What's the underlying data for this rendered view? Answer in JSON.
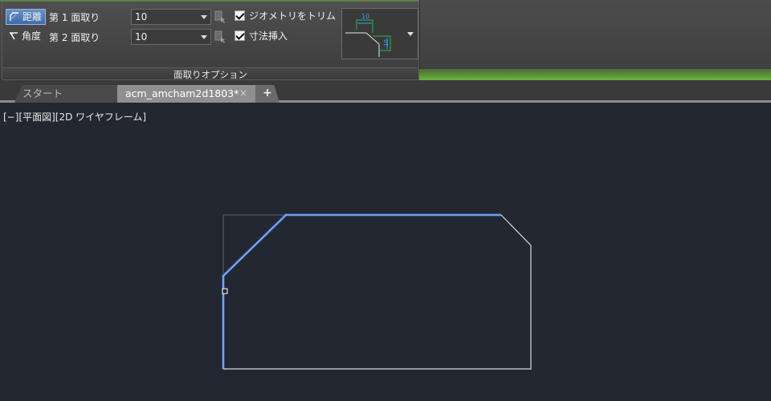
{
  "ribbon": {
    "panel_title": "面取りオプション",
    "mode_distance": {
      "label": "距離",
      "icon": "chamfer-distance-icon"
    },
    "mode_angle": {
      "label": "角度",
      "icon": "chamfer-angle-icon"
    },
    "first_chamfer": {
      "label": "第 1 面取り",
      "value": "10"
    },
    "second_chamfer": {
      "label": "第 2 面取り",
      "value": "10"
    },
    "trim_geometry": {
      "label": "ジオメトリをトリム",
      "checked": true
    },
    "insert_dimension": {
      "label": "寸法挿入",
      "checked": true
    },
    "preview": {
      "dim_value_top": "10",
      "dim_value_right": "10"
    }
  },
  "tabs": [
    {
      "label": "スタート",
      "active": false
    },
    {
      "label": "acm_amcham2d1803*",
      "active": true,
      "close": "×"
    }
  ],
  "tab_add": "+",
  "viewport": {
    "label": "[−][平面図][2D ワイヤフレーム]"
  },
  "colors": {
    "canvas_bg": "#222731",
    "highlight": "#6fa0ff",
    "geometry": "#d8dbe0",
    "ribbon_accent": "#6cb43e"
  }
}
